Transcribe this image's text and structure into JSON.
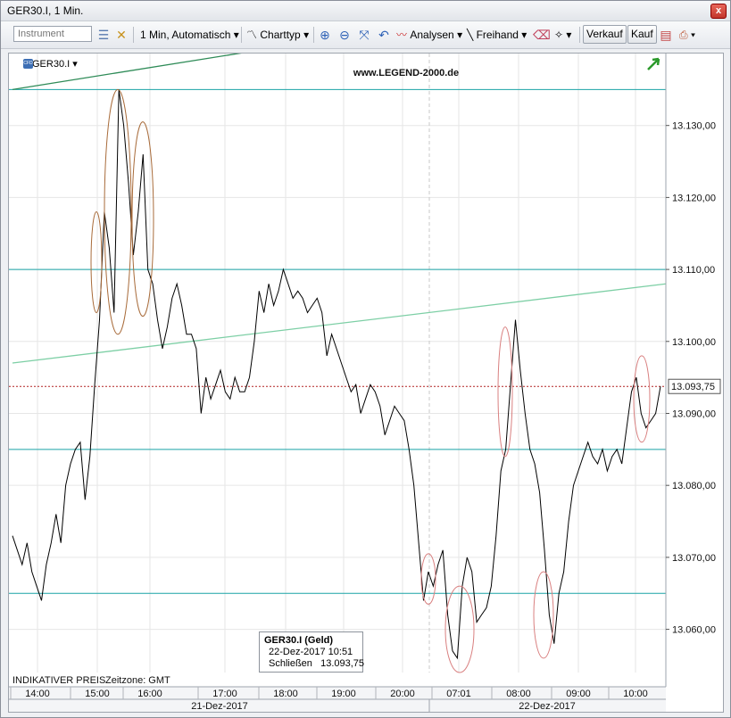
{
  "window": {
    "title": "GER30.I, 1 Min.",
    "close_glyph": "x"
  },
  "toolbar": {
    "instrument_placeholder": "Instrument",
    "interval_label": "1 Min, Automatisch",
    "charttyp_label": "Charttyp",
    "analysen_label": "Analysen",
    "freihand_label": "Freihand",
    "verkauf_label": "Verkauf",
    "kauf_label": "Kauf"
  },
  "chart_header": {
    "symbol": "GER30.I",
    "watermark": "www.LEGEND-2000.de",
    "cfd_badge": "CFD"
  },
  "footer": {
    "indicative_label": "INDIKATIVER PREIS",
    "timezone_label": "Zeitzone: GMT"
  },
  "tooltip": {
    "title": "GER30.I (Geld)",
    "datetime": "22-Dez-2017 10:51",
    "close_label": "Schließen",
    "close_value": "13.093,75"
  },
  "current_price_label": "13.093,75",
  "colors": {
    "price_line": "#000000",
    "support_lines": "#1aa3a6",
    "trend_upper": "#2e8b57",
    "trend_lower": "#7dcfa5",
    "current_price_line": "#b22222",
    "ellipses": "#d98080",
    "ellipse_brown": "#a86b3a"
  },
  "chart_data": {
    "type": "line",
    "series": [
      {
        "name": "GER30.I",
        "values": [
          13073,
          13071,
          13069,
          13072,
          13068,
          13066,
          13064,
          13069,
          13072,
          13076,
          13072,
          13080,
          13083,
          13085,
          13086,
          13078,
          13084,
          13094,
          13103,
          13118,
          13113,
          13104,
          13135,
          13130,
          13122,
          13112,
          13118,
          13126,
          13110,
          13108,
          13103,
          13099,
          13102,
          13106,
          13108,
          13105,
          13101,
          13101,
          13099,
          13090,
          13095,
          13092,
          13094,
          13096,
          13093,
          13092,
          13095,
          13093,
          13093,
          13095,
          13100,
          13107,
          13104,
          13108,
          13105,
          13107,
          13110,
          13108,
          13106,
          13107,
          13106,
          13104,
          13105,
          13106,
          13104,
          13098,
          13101,
          13099,
          13097,
          13095,
          13093,
          13094,
          13090,
          13092,
          13094,
          13093,
          13091,
          13087,
          13089,
          13091,
          13090,
          13089,
          13085,
          13080,
          13072,
          13064,
          13068,
          13066,
          13069,
          13071,
          13062,
          13057,
          13056,
          13066,
          13070,
          13068,
          13061,
          13062,
          13063,
          13066,
          13073,
          13082,
          13085,
          13094,
          13103,
          13096,
          13090,
          13085,
          13083,
          13079,
          13071,
          13062,
          13058,
          13065,
          13068,
          13075,
          13080,
          13082,
          13084,
          13086,
          13084,
          13083,
          13085,
          13082,
          13084,
          13085,
          13083,
          13088,
          13093,
          13095,
          13090,
          13088,
          13089,
          13090,
          13093.75
        ]
      }
    ],
    "x_start": "13:30",
    "x_ticks": [
      "14:00",
      "15:00",
      "16:00",
      "17:00",
      "18:00",
      "19:00",
      "20:00",
      "07:01",
      "08:00",
      "09:00",
      "10:00"
    ],
    "date_labels": [
      "21-Dez-2017",
      "22-Dez-2017"
    ],
    "y_ticks": [
      "13.130,00",
      "13.120,00",
      "13.110,00",
      "13.100,00",
      "13.090,00",
      "13.080,00",
      "13.070,00",
      "13.060,00"
    ],
    "ylim": [
      13054,
      13140
    ],
    "horizontal_levels": [
      13135,
      13110,
      13085,
      13065
    ],
    "current_price": 13093.75,
    "trendlines": [
      {
        "from": [
          "13:30",
          13135
        ],
        "to": [
          "08:20",
          13146
        ]
      },
      {
        "from": [
          "13:30",
          13097
        ],
        "to": [
          "10:51",
          13108
        ]
      }
    ],
    "xlabel": "",
    "ylabel": "",
    "grid": true,
    "legend": "none"
  }
}
